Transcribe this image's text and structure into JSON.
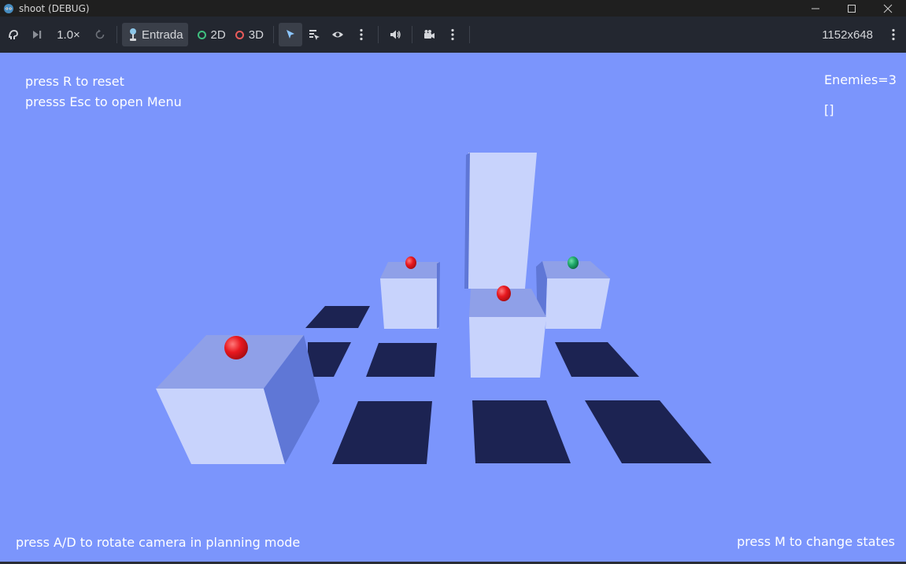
{
  "window": {
    "title": "shoot (DEBUG)",
    "app_icon": "godot-icon",
    "controls": [
      "minimize-icon",
      "maximize-icon",
      "close-icon"
    ]
  },
  "toolbar": {
    "speed_label": "1.0×",
    "input_label": "Entrada",
    "mode_2d_label": "2D",
    "mode_3d_label": "3D",
    "resolution": "1152x648",
    "icons": [
      "pause-suspend-icon",
      "next-frame-icon",
      "reset-speed-icon",
      "pointer-select-icon",
      "list-select-icon",
      "eye-visibility-icon",
      "more-options-icon",
      "speaker-icon",
      "camera-override-icon"
    ],
    "colors": {
      "mode_2d": "#3fbf7f",
      "mode_3d": "#e85a5a",
      "background": "#232730",
      "active": "#3a3f49"
    }
  },
  "hud": {
    "reset_hint": "press R to reset",
    "menu_hint": "presss Esc to open Menu",
    "enemies_label": "Enemies=3",
    "list_readout": "[]",
    "camera_hint": "press A/D to rotate camera in planning mode",
    "states_hint": "press M to change states"
  },
  "scene": {
    "sky_color": "#7b95fc",
    "tile_color": "#1c2352",
    "box_top": "#8fa0e8",
    "box_front": "#c8d3fc",
    "box_side": "#5f77d6",
    "enemy_color": "#e8181f",
    "player_color": "#1fa96b",
    "enemy_count": 3
  }
}
